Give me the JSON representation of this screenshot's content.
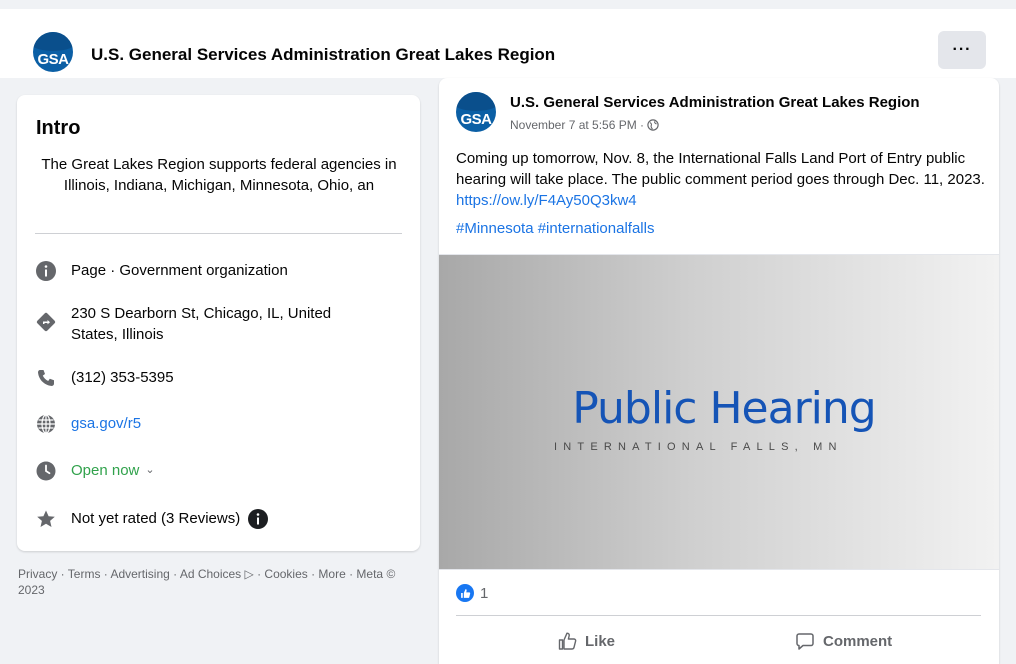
{
  "header": {
    "logo_text": "GSA",
    "page_name": "U.S. General Services Administration Great Lakes Region",
    "more_label": "···"
  },
  "intro": {
    "title": "Intro",
    "description": "The Great Lakes Region supports federal agencies in Illinois, Indiana, Michigan, Minnesota, Ohio, an",
    "items": [
      {
        "icon": "info-icon",
        "text": "Page · Government organization"
      },
      {
        "icon": "directions-icon",
        "text": "230 S Dearborn St, Chicago, IL, United States, Illinois"
      },
      {
        "icon": "phone-icon",
        "text": "(312) 353-5395"
      },
      {
        "icon": "globe-icon",
        "text": "gsa.gov/r5"
      },
      {
        "icon": "clock-icon",
        "text": "Open now"
      },
      {
        "icon": "star-icon",
        "text": "Not yet rated (3 Reviews)"
      }
    ]
  },
  "footer": {
    "text": "Privacy · Terms · Advertising · Ad Choices ▷ · Cookies · More · Meta © 2023"
  },
  "post": {
    "logo_text": "GSA",
    "author": "U.S. General Services Administration Great Lakes Region",
    "timestamp": "November 7 at 5:56 PM · ",
    "body_text": "Coming up tomorrow, Nov. 8, the International Falls Land Port of Entry public hearing will take place. The public comment period goes through Dec. 11, 2023. ",
    "body_link": "https://ow.ly/F4Ay50Q3kw4",
    "hashtags": "#Minnesota #internationalfalls",
    "image_title": "Public Hearing",
    "image_subtitle": "INTERNATIONAL FALLS, MN",
    "reaction_count": "1",
    "like_label": "Like",
    "comment_label": "Comment"
  },
  "colors": {
    "link": "#1b74e4",
    "open_status": "#31a24c",
    "brand": "#0b5fa5"
  }
}
